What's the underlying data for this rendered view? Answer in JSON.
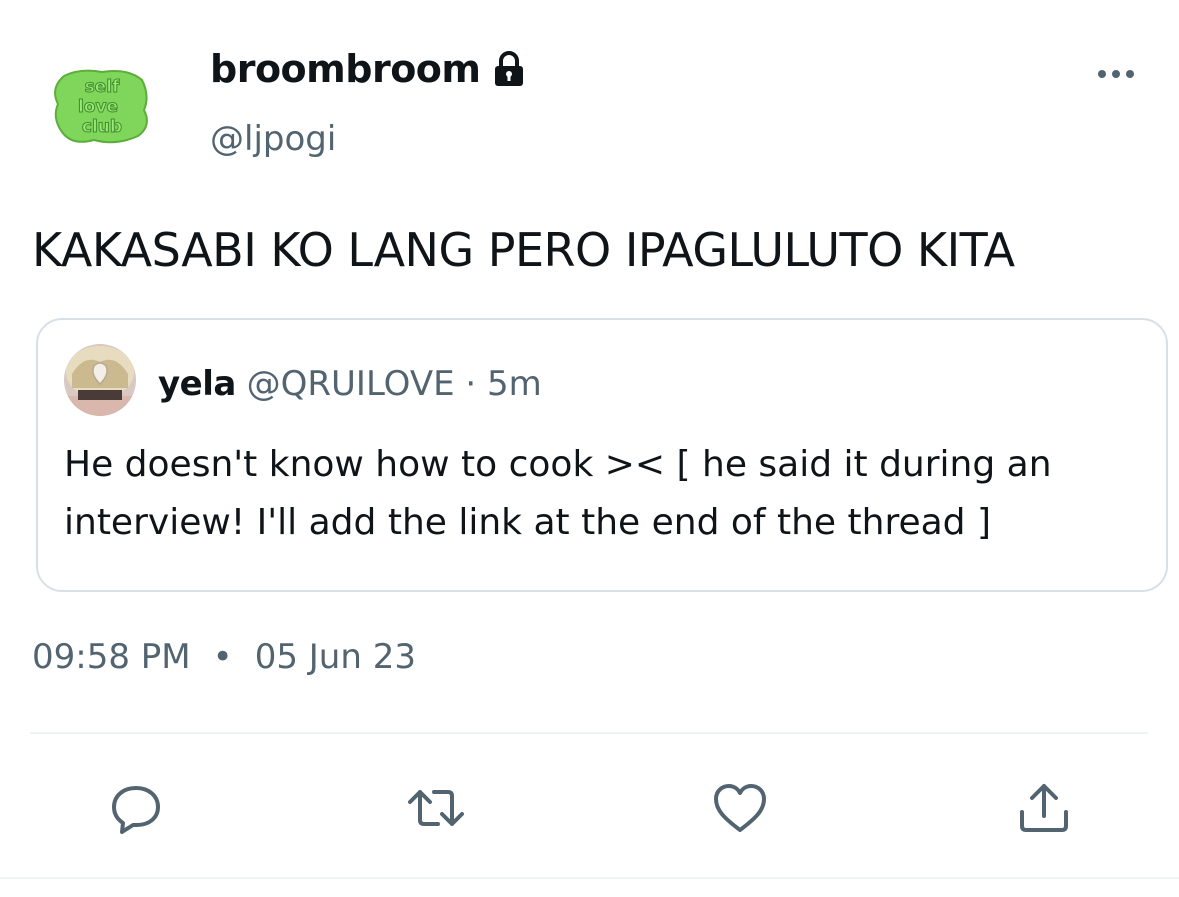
{
  "author": {
    "display_name": "broombroom",
    "handle": "@ljpogi",
    "avatar_logo_text": "self love club",
    "protected": true
  },
  "tweet": {
    "text": "KAKASABI KO LANG PERO IPAGLULUTO KITA",
    "time": "09:58 PM",
    "separator": "•",
    "date": "05 Jun 23"
  },
  "quote": {
    "name": "yela",
    "handle": "@QRUILOVE",
    "dot": "·",
    "time": "5m",
    "text_line1": "He doesn't know how to cook >< [ he said it during an",
    "text_line2": "interview! I'll add the link at the end of the thread ]"
  },
  "actions": {
    "reply": "reply-icon",
    "retweet": "retweet-icon",
    "like": "heart-icon",
    "share": "share-icon"
  },
  "colors": {
    "text_primary": "#0f1419",
    "text_secondary": "#536471",
    "border": "#d9e0e5",
    "avatar_green": "#7fd65a"
  }
}
